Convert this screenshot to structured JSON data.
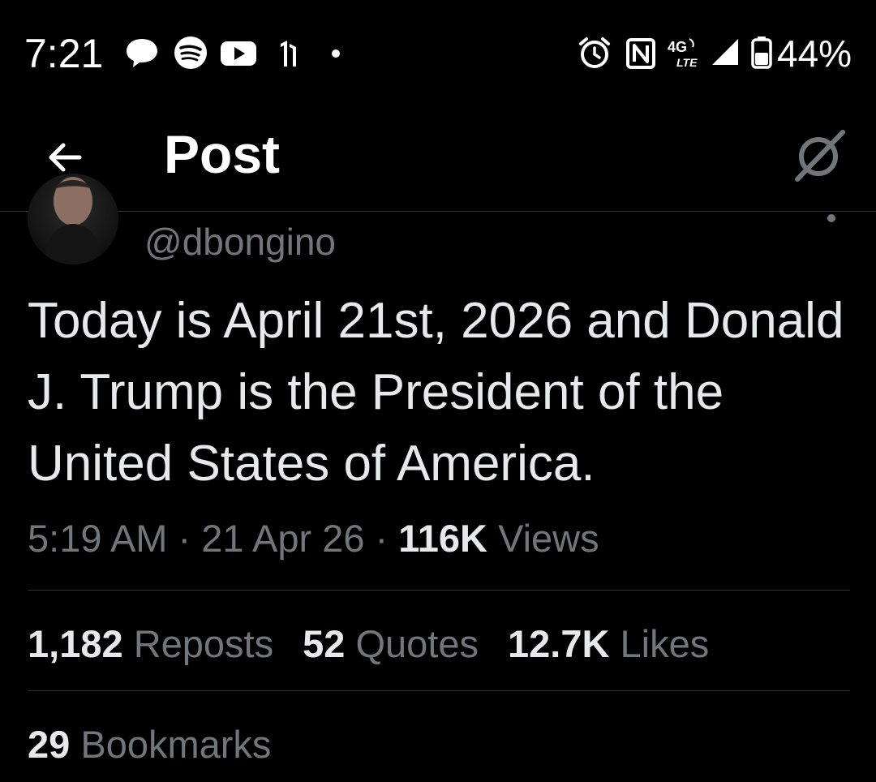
{
  "status_bar": {
    "time": "7:21",
    "battery_percent": "44%",
    "network": "4G LTE",
    "left_icons": [
      "chat-bubble-icon",
      "spotify-icon",
      "youtube-icon",
      "app-notification-icon",
      "dot-icon"
    ],
    "right_icons": [
      "alarm-icon",
      "nfc-icon",
      "lte-icon",
      "signal-icon",
      "battery-icon"
    ]
  },
  "header": {
    "title": "Post",
    "back_icon": "arrow-left-icon",
    "grok_icon": "grok-icon"
  },
  "post": {
    "handle": "@dbongino",
    "text": "Today is April 21st, 2026 and Donald J. Trump is the President of the United States of America.",
    "time": "5:19 AM",
    "date": "21 Apr 26",
    "separator": "·",
    "views_count": "116K",
    "views_label": "Views"
  },
  "stats": {
    "reposts_count": "1,182",
    "reposts_label": "Reposts",
    "quotes_count": "52",
    "quotes_label": "Quotes",
    "likes_count": "12.7K",
    "likes_label": "Likes",
    "bookmarks_count": "29",
    "bookmarks_label": "Bookmarks"
  },
  "colors": {
    "background": "#000000",
    "text_primary": "#e7e9ea",
    "text_secondary": "#71767b",
    "divider": "#2f3336"
  }
}
